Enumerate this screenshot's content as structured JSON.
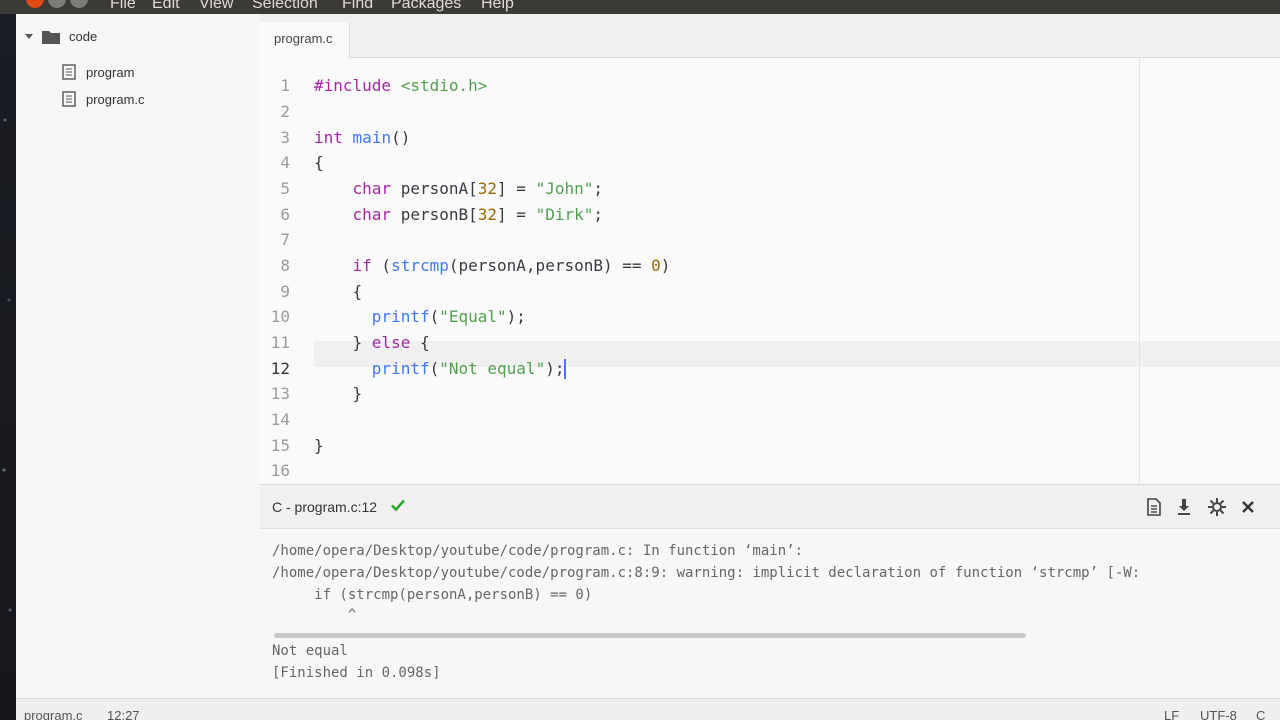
{
  "menubar": {
    "items": [
      "File",
      "Edit",
      "View",
      "Selection",
      "Find",
      "Packages",
      "Help"
    ]
  },
  "sidebar": {
    "folder": "code",
    "files": [
      "program",
      "program.c"
    ]
  },
  "editor": {
    "tab": "program.c",
    "line_numbers": [
      "1",
      "2",
      "3",
      "4",
      "5",
      "6",
      "7",
      "8",
      "9",
      "10",
      "11",
      "12",
      "13",
      "14",
      "15",
      "16"
    ],
    "current_line": "12"
  },
  "panel": {
    "title": "C - program.c:12",
    "output": [
      "/home/opera/Desktop/youtube/code/program.c: In function ‘main’:",
      "/home/opera/Desktop/youtube/code/program.c:8:9: warning: implicit declaration of function ‘strcmp’ [-W:",
      "     if (strcmp(personA,personB) == 0)",
      "         ^",
      "Not equal",
      "[Finished in 0.098s]"
    ]
  },
  "statusbar": {
    "file": "program.c",
    "position": "12:27",
    "line_ending": "LF",
    "encoding": "UTF-8",
    "grammar": "C"
  },
  "colors": {
    "keyword": "#a626a4",
    "function": "#4078f2",
    "string": "#50a14f",
    "number": "#986801",
    "success": "#2fa52f",
    "cursor": "#526fff"
  }
}
